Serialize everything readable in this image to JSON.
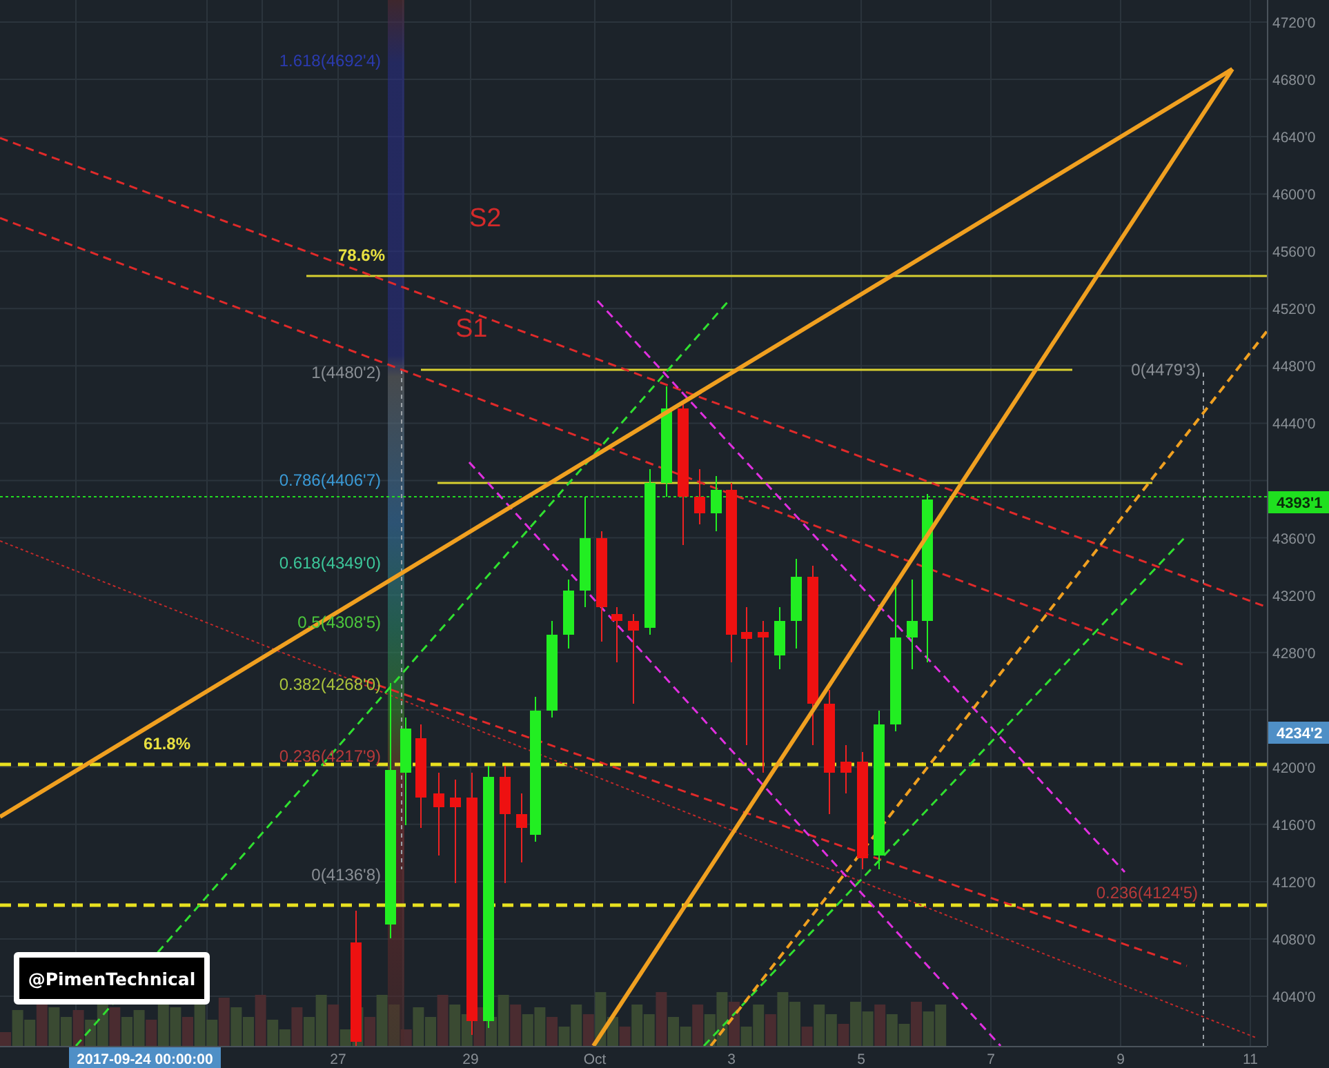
{
  "chart": {
    "annotations": [
      {
        "kind": "support",
        "text": "S2"
      },
      {
        "kind": "level",
        "text": "78.6%"
      },
      {
        "kind": "support",
        "text": "S1"
      },
      {
        "kind": "level",
        "text": "61.8%"
      }
    ],
    "fib_levels": [
      {
        "text": "1.618(4692'4)",
        "color": "#2b3bb0"
      },
      {
        "text": "1(4480'2)",
        "color": "#8a8f95"
      },
      {
        "text": "0.786(4406'7)",
        "color": "#3a9ad6"
      },
      {
        "text": "0.618(4349'0)",
        "color": "#3cc79a"
      },
      {
        "text": "0.5(4308'5)",
        "color": "#4cc83c"
      },
      {
        "text": "0.382(4268'0)",
        "color": "#aac43c"
      },
      {
        "text": "0.236(4217'9)",
        "color": "#b83a3a"
      },
      {
        "text": "0(4136'8)",
        "color": "#8a8f95"
      }
    ],
    "fib_levels_right": [
      {
        "text": "0(4479'3)",
        "color": "#8a8f95"
      },
      {
        "text": "0.236(4124'5)",
        "color": "#b83a3a"
      }
    ],
    "tag": "@PimenTechnical"
  },
  "price_axis": {
    "labels": [
      "4720'0",
      "4680'0",
      "4640'0",
      "4600'0",
      "4560'0",
      "4520'0",
      "4480'0",
      "4440'0",
      "4360'0",
      "4320'0",
      "4280'0",
      "4200'0",
      "4160'0",
      "4120'0",
      "4080'0",
      "4040'0"
    ],
    "markers": [
      {
        "text": "4393'1",
        "color": "#1fe01f"
      },
      {
        "text": "4234'2",
        "color": "#4f8fc6"
      }
    ]
  },
  "time_axis": {
    "cursor": "2017-09-24 00:00:00",
    "labels": [
      "27",
      "29",
      "Oct",
      "3",
      "5",
      "7",
      "9",
      "11"
    ]
  }
}
